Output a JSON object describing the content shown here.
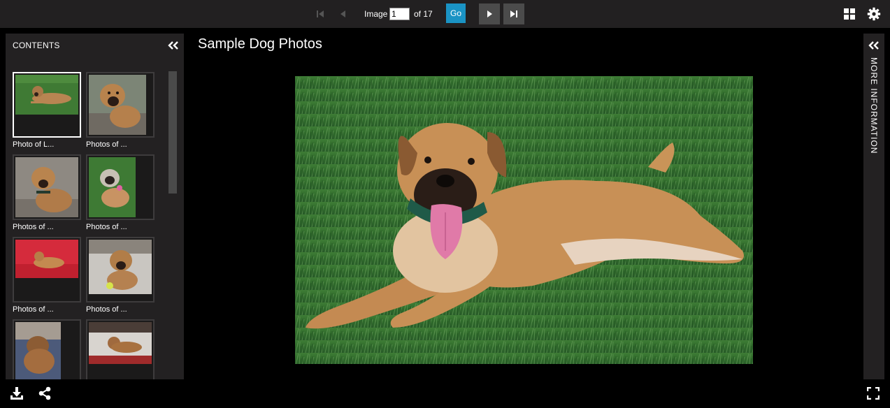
{
  "toolbar": {
    "image_label": "Image",
    "page_value": "1",
    "of_label": "of 17",
    "go_label": "Go",
    "icons": [
      "first-page-icon",
      "previous-icon",
      "next-icon",
      "last-page-icon",
      "grid-view-icon",
      "gear-icon"
    ]
  },
  "sidebar": {
    "title": "CONTENTS",
    "collapse_icon": "double-chevron-left-icon",
    "items": [
      {
        "caption": "Photo of L...",
        "selected": true
      },
      {
        "caption": "Photos of ...",
        "selected": false
      },
      {
        "caption": "Photos of ...",
        "selected": false
      },
      {
        "caption": "Photos of ...",
        "selected": false
      },
      {
        "caption": "Photos of ...",
        "selected": false
      },
      {
        "caption": "Photos of ...",
        "selected": false
      },
      {
        "caption": "",
        "selected": false
      },
      {
        "caption": "",
        "selected": false
      }
    ]
  },
  "main": {
    "title": "Sample Dog Photos"
  },
  "info_panel": {
    "label": "MORE INFORMATION",
    "collapse_icon": "double-chevron-left-icon"
  },
  "footer": {
    "icons": [
      "download-icon",
      "share-icon",
      "fullscreen-icon"
    ]
  },
  "colors": {
    "accent": "#1a93c4",
    "panel": "#232122",
    "toolbar": "#222021",
    "background": "#000000"
  }
}
